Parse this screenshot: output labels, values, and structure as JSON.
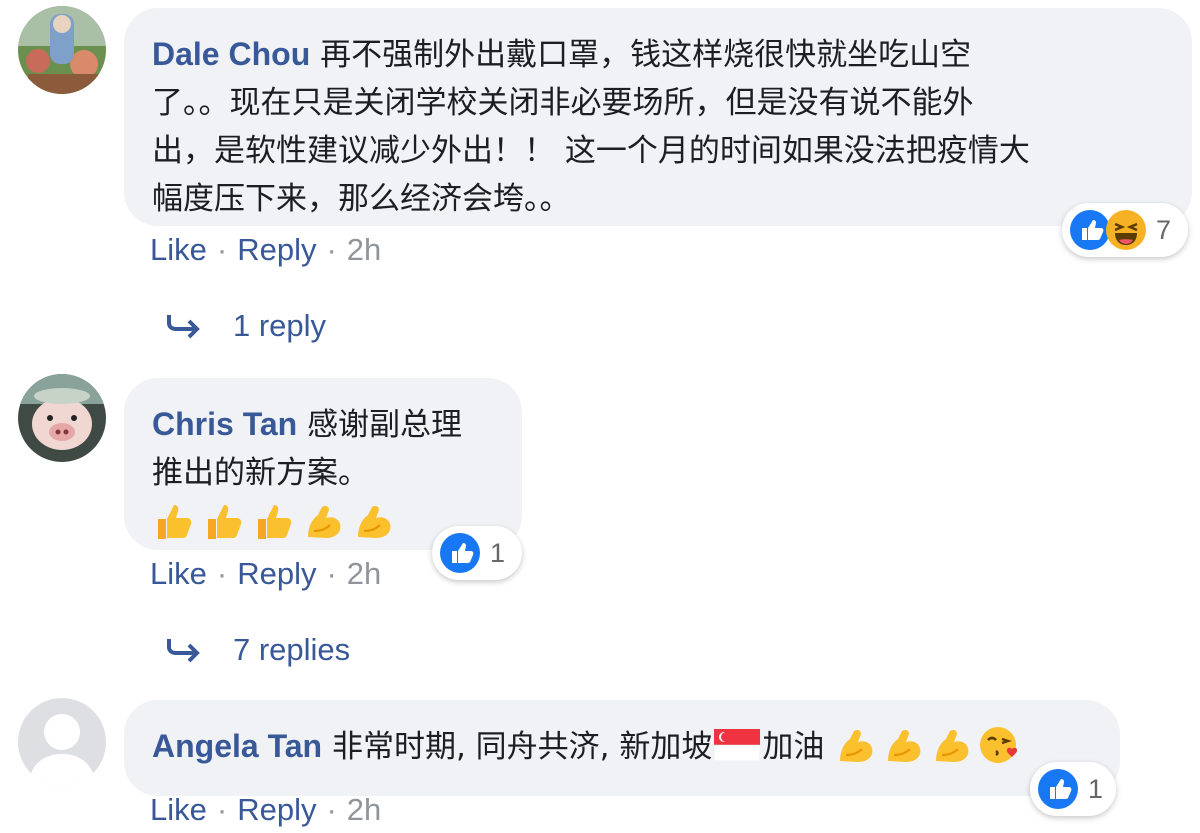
{
  "comments": [
    {
      "author": "Dale Chou",
      "text": "再不强制外出戴口罩，钱这样烧很快就坐吃山空了。。现在只是关闭学校关闭非必要场所，但是没有说不能外出，是软性建议减少外出！！ 这一个月的时间如果没法把疫情大幅度压下来，那么经济会垮。。",
      "lines": [
        "再不强制外出戴口罩，钱这样烧很快就坐吃山空",
        "了。。现在只是关闭学校关闭非必要场所，但是没有说不能外",
        "出，是软性建议减少外出！！ 这一个月的时间如果没法把疫情大",
        "幅度压下来，那么经济会垮。。"
      ],
      "reactions": [
        "like-icon",
        "haha-icon"
      ],
      "reaction_count": "7",
      "like_label": "Like",
      "reply_label": "Reply",
      "time": "2h",
      "replies_label": "1 reply"
    },
    {
      "author": "Chris Tan",
      "lines": [
        "感谢副总理",
        "推出的新方案。"
      ],
      "emojis": [
        "thumbs-up",
        "thumbs-up",
        "thumbs-up",
        "flexed-biceps",
        "flexed-biceps"
      ],
      "reactions": [
        "like-icon"
      ],
      "reaction_count": "1",
      "like_label": "Like",
      "reply_label": "Reply",
      "time": "2h",
      "replies_label": "7 replies"
    },
    {
      "author": "Angela Tan",
      "text_before_flag": "非常时期, 同舟共济, 新加坡",
      "flag": "singapore-flag",
      "text_after_flag": "加油",
      "emojis": [
        "flexed-biceps",
        "flexed-biceps",
        "flexed-biceps",
        "face-blowing-kiss"
      ],
      "reactions": [
        "like-icon"
      ],
      "reaction_count": "1",
      "like_label": "Like",
      "reply_label": "Reply",
      "time": "2h"
    }
  ],
  "colors": {
    "name": "#385898",
    "bubble": "#f0f2f5",
    "like_blue": "#1877f2",
    "meta_gray": "#90949c"
  }
}
